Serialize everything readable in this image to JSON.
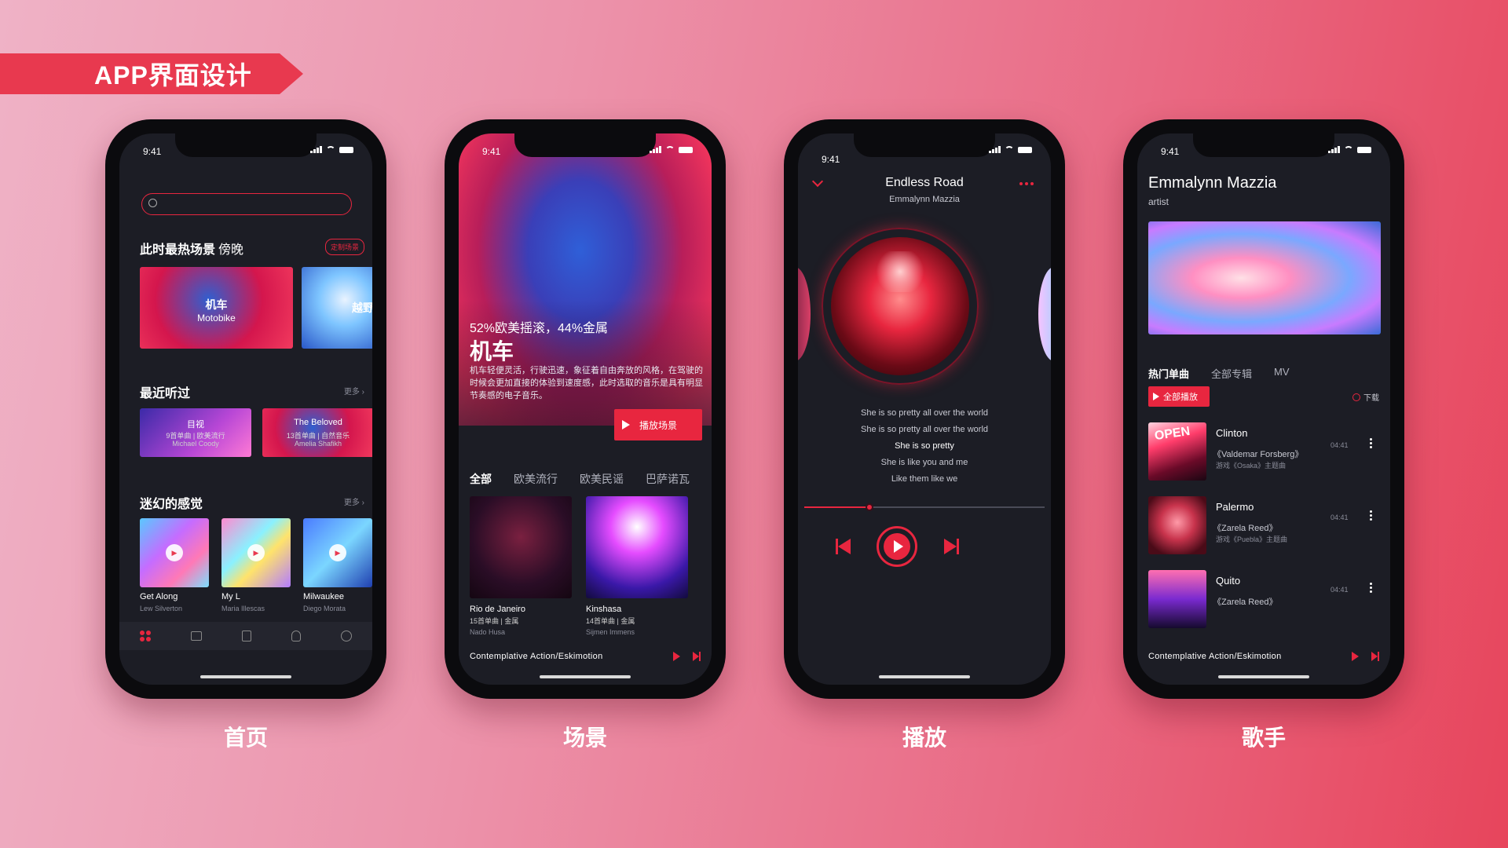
{
  "banner": {
    "title": "APP界面设计"
  },
  "status": {
    "time": "9:41"
  },
  "screens": {
    "home": {
      "label": "首页",
      "hot_title": "此时最热场景",
      "hot_time": "傍晚",
      "custom_btn": "定制场景",
      "scene1_cn": "机车",
      "scene1_en": "Motobike",
      "scene2_cn": "越野",
      "recent_title": "最近听过",
      "more": "更多",
      "recent1": {
        "title": "目视",
        "meta": "9首单曲 | 欧美流行",
        "artist": "Michael Coody"
      },
      "recent2": {
        "title": "The Beloved",
        "meta": "13首单曲 | 自然音乐",
        "artist": "Amelia Shafikh"
      },
      "dreamy_title": "迷幻的感觉",
      "songs": [
        {
          "title": "Get Along",
          "artist": "Lew Silverton"
        },
        {
          "title": "My L",
          "artist": "Maria Illescas"
        },
        {
          "title": "Milwaukee",
          "artist": "Diego Morata"
        }
      ],
      "nav_icons": [
        "home-icon",
        "video-icon",
        "list-icon",
        "bulb-icon",
        "play-circle-icon"
      ]
    },
    "scene": {
      "label": "场景",
      "stats": "52%欧美摇滚，44%金属",
      "title": "机车",
      "desc": "机车轻便灵活，行驶迅速，象征着自由奔放的风格，在驾驶的时候会更加直接的体验到速度感，此时选取的音乐是具有明显节奏感的电子音乐。",
      "play_btn": "播放场景",
      "tabs": [
        "全部",
        "欧美流行",
        "欧美民谣",
        "巴萨诺瓦"
      ],
      "albums": [
        {
          "title": "Rio de Janeiro",
          "meta": "15首单曲 | 金属",
          "artist": "Nado Husa"
        },
        {
          "title": "Kinshasa",
          "meta": "14首单曲 | 金属",
          "artist": "Sijmen Immens"
        }
      ],
      "now_playing": "Contemplative Action/Eskimotion"
    },
    "player": {
      "label": "播放",
      "song": "Endless Road",
      "artist": "Emmalynn Mazzia",
      "lyrics": [
        "She is so pretty all over the world",
        "She is so pretty all over the world",
        "She is so pretty",
        "She is like you and me",
        "Like them like we"
      ],
      "progress": 0.27
    },
    "artist": {
      "label": "歌手",
      "name": "Emmalynn Mazzia",
      "role": "artist",
      "tabs": [
        "热门单曲",
        "全部专辑",
        "MV"
      ],
      "play_all": "全部播放",
      "download": "下载",
      "tracks": [
        {
          "title": "Clinton",
          "artist": "《Valdemar Forsberg》",
          "meta": "游戏《Osaka》主题曲",
          "duration": "04:41",
          "thumb_text": "OPEN"
        },
        {
          "title": "Palermo",
          "artist": "《Zarela Reed》",
          "meta": "游戏《Puebla》主题曲",
          "duration": "04:41"
        },
        {
          "title": "Quito",
          "artist": "《Zarela Reed》",
          "meta": "",
          "duration": "04:41"
        }
      ],
      "now_playing": "Contemplative Action/Eskimotion"
    }
  },
  "colors": {
    "accent": "#e8263f",
    "screen_bg": "#1c1d25"
  }
}
